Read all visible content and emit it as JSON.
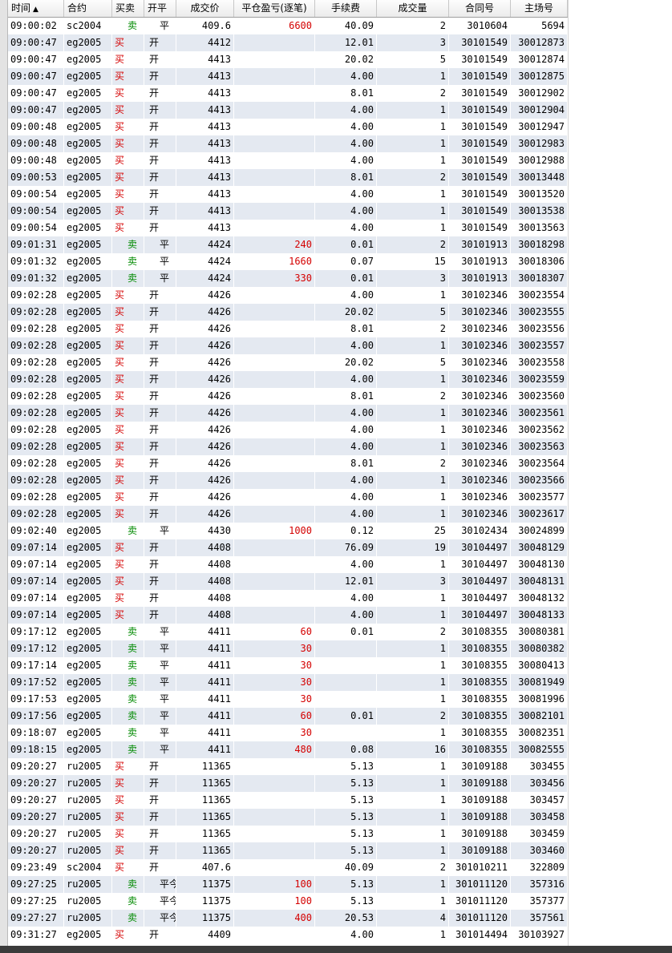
{
  "columns": {
    "time": "时间",
    "sort_indicator": "▲",
    "contract": "合约",
    "direction": "买卖",
    "open_close": "开平",
    "price": "成交价",
    "pnl": "平仓盈亏(逐笔)",
    "fee": "手续费",
    "volume": "成交量",
    "contract_id": "合同号",
    "trade_id": "主场号"
  },
  "colors": {
    "buy": "#d40000",
    "sell": "#008a00",
    "pnl": "#d40000",
    "row_alt": "#e4e9f1"
  },
  "rows": [
    {
      "time": "09:00:02",
      "contract": "sc2004",
      "dir": "卖",
      "oc": "平",
      "price": "409.6",
      "pnl": "6600",
      "fee": "40.09",
      "vol": "2",
      "cid": "3010604",
      "tid": "5694"
    },
    {
      "time": "09:00:47",
      "contract": "eg2005",
      "dir": "买",
      "oc": "开",
      "price": "4412",
      "pnl": "",
      "fee": "12.01",
      "vol": "3",
      "cid": "30101549",
      "tid": "30012873"
    },
    {
      "time": "09:00:47",
      "contract": "eg2005",
      "dir": "买",
      "oc": "开",
      "price": "4413",
      "pnl": "",
      "fee": "20.02",
      "vol": "5",
      "cid": "30101549",
      "tid": "30012874"
    },
    {
      "time": "09:00:47",
      "contract": "eg2005",
      "dir": "买",
      "oc": "开",
      "price": "4413",
      "pnl": "",
      "fee": "4.00",
      "vol": "1",
      "cid": "30101549",
      "tid": "30012875"
    },
    {
      "time": "09:00:47",
      "contract": "eg2005",
      "dir": "买",
      "oc": "开",
      "price": "4413",
      "pnl": "",
      "fee": "8.01",
      "vol": "2",
      "cid": "30101549",
      "tid": "30012902"
    },
    {
      "time": "09:00:47",
      "contract": "eg2005",
      "dir": "买",
      "oc": "开",
      "price": "4413",
      "pnl": "",
      "fee": "4.00",
      "vol": "1",
      "cid": "30101549",
      "tid": "30012904"
    },
    {
      "time": "09:00:48",
      "contract": "eg2005",
      "dir": "买",
      "oc": "开",
      "price": "4413",
      "pnl": "",
      "fee": "4.00",
      "vol": "1",
      "cid": "30101549",
      "tid": "30012947"
    },
    {
      "time": "09:00:48",
      "contract": "eg2005",
      "dir": "买",
      "oc": "开",
      "price": "4413",
      "pnl": "",
      "fee": "4.00",
      "vol": "1",
      "cid": "30101549",
      "tid": "30012983"
    },
    {
      "time": "09:00:48",
      "contract": "eg2005",
      "dir": "买",
      "oc": "开",
      "price": "4413",
      "pnl": "",
      "fee": "4.00",
      "vol": "1",
      "cid": "30101549",
      "tid": "30012988"
    },
    {
      "time": "09:00:53",
      "contract": "eg2005",
      "dir": "买",
      "oc": "开",
      "price": "4413",
      "pnl": "",
      "fee": "8.01",
      "vol": "2",
      "cid": "30101549",
      "tid": "30013448"
    },
    {
      "time": "09:00:54",
      "contract": "eg2005",
      "dir": "买",
      "oc": "开",
      "price": "4413",
      "pnl": "",
      "fee": "4.00",
      "vol": "1",
      "cid": "30101549",
      "tid": "30013520"
    },
    {
      "time": "09:00:54",
      "contract": "eg2005",
      "dir": "买",
      "oc": "开",
      "price": "4413",
      "pnl": "",
      "fee": "4.00",
      "vol": "1",
      "cid": "30101549",
      "tid": "30013538"
    },
    {
      "time": "09:00:54",
      "contract": "eg2005",
      "dir": "买",
      "oc": "开",
      "price": "4413",
      "pnl": "",
      "fee": "4.00",
      "vol": "1",
      "cid": "30101549",
      "tid": "30013563"
    },
    {
      "time": "09:01:31",
      "contract": "eg2005",
      "dir": "卖",
      "oc": "平",
      "price": "4424",
      "pnl": "240",
      "fee": "0.01",
      "vol": "2",
      "cid": "30101913",
      "tid": "30018298"
    },
    {
      "time": "09:01:32",
      "contract": "eg2005",
      "dir": "卖",
      "oc": "平",
      "price": "4424",
      "pnl": "1660",
      "fee": "0.07",
      "vol": "15",
      "cid": "30101913",
      "tid": "30018306"
    },
    {
      "time": "09:01:32",
      "contract": "eg2005",
      "dir": "卖",
      "oc": "平",
      "price": "4424",
      "pnl": "330",
      "fee": "0.01",
      "vol": "3",
      "cid": "30101913",
      "tid": "30018307"
    },
    {
      "time": "09:02:28",
      "contract": "eg2005",
      "dir": "买",
      "oc": "开",
      "price": "4426",
      "pnl": "",
      "fee": "4.00",
      "vol": "1",
      "cid": "30102346",
      "tid": "30023554"
    },
    {
      "time": "09:02:28",
      "contract": "eg2005",
      "dir": "买",
      "oc": "开",
      "price": "4426",
      "pnl": "",
      "fee": "20.02",
      "vol": "5",
      "cid": "30102346",
      "tid": "30023555"
    },
    {
      "time": "09:02:28",
      "contract": "eg2005",
      "dir": "买",
      "oc": "开",
      "price": "4426",
      "pnl": "",
      "fee": "8.01",
      "vol": "2",
      "cid": "30102346",
      "tid": "30023556"
    },
    {
      "time": "09:02:28",
      "contract": "eg2005",
      "dir": "买",
      "oc": "开",
      "price": "4426",
      "pnl": "",
      "fee": "4.00",
      "vol": "1",
      "cid": "30102346",
      "tid": "30023557"
    },
    {
      "time": "09:02:28",
      "contract": "eg2005",
      "dir": "买",
      "oc": "开",
      "price": "4426",
      "pnl": "",
      "fee": "20.02",
      "vol": "5",
      "cid": "30102346",
      "tid": "30023558"
    },
    {
      "time": "09:02:28",
      "contract": "eg2005",
      "dir": "买",
      "oc": "开",
      "price": "4426",
      "pnl": "",
      "fee": "4.00",
      "vol": "1",
      "cid": "30102346",
      "tid": "30023559"
    },
    {
      "time": "09:02:28",
      "contract": "eg2005",
      "dir": "买",
      "oc": "开",
      "price": "4426",
      "pnl": "",
      "fee": "8.01",
      "vol": "2",
      "cid": "30102346",
      "tid": "30023560"
    },
    {
      "time": "09:02:28",
      "contract": "eg2005",
      "dir": "买",
      "oc": "开",
      "price": "4426",
      "pnl": "",
      "fee": "4.00",
      "vol": "1",
      "cid": "30102346",
      "tid": "30023561"
    },
    {
      "time": "09:02:28",
      "contract": "eg2005",
      "dir": "买",
      "oc": "开",
      "price": "4426",
      "pnl": "",
      "fee": "4.00",
      "vol": "1",
      "cid": "30102346",
      "tid": "30023562"
    },
    {
      "time": "09:02:28",
      "contract": "eg2005",
      "dir": "买",
      "oc": "开",
      "price": "4426",
      "pnl": "",
      "fee": "4.00",
      "vol": "1",
      "cid": "30102346",
      "tid": "30023563"
    },
    {
      "time": "09:02:28",
      "contract": "eg2005",
      "dir": "买",
      "oc": "开",
      "price": "4426",
      "pnl": "",
      "fee": "8.01",
      "vol": "2",
      "cid": "30102346",
      "tid": "30023564"
    },
    {
      "time": "09:02:28",
      "contract": "eg2005",
      "dir": "买",
      "oc": "开",
      "price": "4426",
      "pnl": "",
      "fee": "4.00",
      "vol": "1",
      "cid": "30102346",
      "tid": "30023566"
    },
    {
      "time": "09:02:28",
      "contract": "eg2005",
      "dir": "买",
      "oc": "开",
      "price": "4426",
      "pnl": "",
      "fee": "4.00",
      "vol": "1",
      "cid": "30102346",
      "tid": "30023577"
    },
    {
      "time": "09:02:28",
      "contract": "eg2005",
      "dir": "买",
      "oc": "开",
      "price": "4426",
      "pnl": "",
      "fee": "4.00",
      "vol": "1",
      "cid": "30102346",
      "tid": "30023617"
    },
    {
      "time": "09:02:40",
      "contract": "eg2005",
      "dir": "卖",
      "oc": "平",
      "price": "4430",
      "pnl": "1000",
      "fee": "0.12",
      "vol": "25",
      "cid": "30102434",
      "tid": "30024899"
    },
    {
      "time": "09:07:14",
      "contract": "eg2005",
      "dir": "买",
      "oc": "开",
      "price": "4408",
      "pnl": "",
      "fee": "76.09",
      "vol": "19",
      "cid": "30104497",
      "tid": "30048129"
    },
    {
      "time": "09:07:14",
      "contract": "eg2005",
      "dir": "买",
      "oc": "开",
      "price": "4408",
      "pnl": "",
      "fee": "4.00",
      "vol": "1",
      "cid": "30104497",
      "tid": "30048130"
    },
    {
      "time": "09:07:14",
      "contract": "eg2005",
      "dir": "买",
      "oc": "开",
      "price": "4408",
      "pnl": "",
      "fee": "12.01",
      "vol": "3",
      "cid": "30104497",
      "tid": "30048131"
    },
    {
      "time": "09:07:14",
      "contract": "eg2005",
      "dir": "买",
      "oc": "开",
      "price": "4408",
      "pnl": "",
      "fee": "4.00",
      "vol": "1",
      "cid": "30104497",
      "tid": "30048132"
    },
    {
      "time": "09:07:14",
      "contract": "eg2005",
      "dir": "买",
      "oc": "开",
      "price": "4408",
      "pnl": "",
      "fee": "4.00",
      "vol": "1",
      "cid": "30104497",
      "tid": "30048133"
    },
    {
      "time": "09:17:12",
      "contract": "eg2005",
      "dir": "卖",
      "oc": "平",
      "price": "4411",
      "pnl": "60",
      "fee": "0.01",
      "vol": "2",
      "cid": "30108355",
      "tid": "30080381"
    },
    {
      "time": "09:17:12",
      "contract": "eg2005",
      "dir": "卖",
      "oc": "平",
      "price": "4411",
      "pnl": "30",
      "fee": "",
      "vol": "1",
      "cid": "30108355",
      "tid": "30080382"
    },
    {
      "time": "09:17:14",
      "contract": "eg2005",
      "dir": "卖",
      "oc": "平",
      "price": "4411",
      "pnl": "30",
      "fee": "",
      "vol": "1",
      "cid": "30108355",
      "tid": "30080413"
    },
    {
      "time": "09:17:52",
      "contract": "eg2005",
      "dir": "卖",
      "oc": "平",
      "price": "4411",
      "pnl": "30",
      "fee": "",
      "vol": "1",
      "cid": "30108355",
      "tid": "30081949"
    },
    {
      "time": "09:17:53",
      "contract": "eg2005",
      "dir": "卖",
      "oc": "平",
      "price": "4411",
      "pnl": "30",
      "fee": "",
      "vol": "1",
      "cid": "30108355",
      "tid": "30081996"
    },
    {
      "time": "09:17:56",
      "contract": "eg2005",
      "dir": "卖",
      "oc": "平",
      "price": "4411",
      "pnl": "60",
      "fee": "0.01",
      "vol": "2",
      "cid": "30108355",
      "tid": "30082101"
    },
    {
      "time": "09:18:07",
      "contract": "eg2005",
      "dir": "卖",
      "oc": "平",
      "price": "4411",
      "pnl": "30",
      "fee": "",
      "vol": "1",
      "cid": "30108355",
      "tid": "30082351"
    },
    {
      "time": "09:18:15",
      "contract": "eg2005",
      "dir": "卖",
      "oc": "平",
      "price": "4411",
      "pnl": "480",
      "fee": "0.08",
      "vol": "16",
      "cid": "30108355",
      "tid": "30082555"
    },
    {
      "time": "09:20:27",
      "contract": "ru2005",
      "dir": "买",
      "oc": "开",
      "price": "11365",
      "pnl": "",
      "fee": "5.13",
      "vol": "1",
      "cid": "30109188",
      "tid": "303455"
    },
    {
      "time": "09:20:27",
      "contract": "ru2005",
      "dir": "买",
      "oc": "开",
      "price": "11365",
      "pnl": "",
      "fee": "5.13",
      "vol": "1",
      "cid": "30109188",
      "tid": "303456"
    },
    {
      "time": "09:20:27",
      "contract": "ru2005",
      "dir": "买",
      "oc": "开",
      "price": "11365",
      "pnl": "",
      "fee": "5.13",
      "vol": "1",
      "cid": "30109188",
      "tid": "303457"
    },
    {
      "time": "09:20:27",
      "contract": "ru2005",
      "dir": "买",
      "oc": "开",
      "price": "11365",
      "pnl": "",
      "fee": "5.13",
      "vol": "1",
      "cid": "30109188",
      "tid": "303458"
    },
    {
      "time": "09:20:27",
      "contract": "ru2005",
      "dir": "买",
      "oc": "开",
      "price": "11365",
      "pnl": "",
      "fee": "5.13",
      "vol": "1",
      "cid": "30109188",
      "tid": "303459"
    },
    {
      "time": "09:20:27",
      "contract": "ru2005",
      "dir": "买",
      "oc": "开",
      "price": "11365",
      "pnl": "",
      "fee": "5.13",
      "vol": "1",
      "cid": "30109188",
      "tid": "303460"
    },
    {
      "time": "09:23:49",
      "contract": "sc2004",
      "dir": "买",
      "oc": "开",
      "price": "407.6",
      "pnl": "",
      "fee": "40.09",
      "vol": "2",
      "cid": "301010211",
      "tid": "322809"
    },
    {
      "time": "09:27:25",
      "contract": "ru2005",
      "dir": "卖",
      "oc": "平今",
      "price": "11375",
      "pnl": "100",
      "fee": "5.13",
      "vol": "1",
      "cid": "301011120",
      "tid": "357316"
    },
    {
      "time": "09:27:25",
      "contract": "ru2005",
      "dir": "卖",
      "oc": "平今",
      "price": "11375",
      "pnl": "100",
      "fee": "5.13",
      "vol": "1",
      "cid": "301011120",
      "tid": "357377"
    },
    {
      "time": "09:27:27",
      "contract": "ru2005",
      "dir": "卖",
      "oc": "平今",
      "price": "11375",
      "pnl": "400",
      "fee": "20.53",
      "vol": "4",
      "cid": "301011120",
      "tid": "357561"
    },
    {
      "time": "09:31:27",
      "contract": "eg2005",
      "dir": "买",
      "oc": "开",
      "price": "4409",
      "pnl": "",
      "fee": "4.00",
      "vol": "1",
      "cid": "301014494",
      "tid": "30103927"
    }
  ]
}
